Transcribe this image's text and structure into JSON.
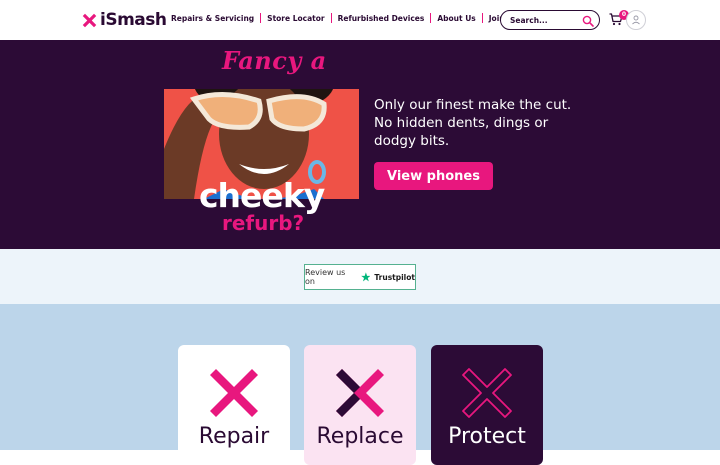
{
  "brand": {
    "name": "iSmash",
    "accent": "#e8177e",
    "dark": "#2c0b36"
  },
  "nav": {
    "items": [
      {
        "label": "Repairs & Servicing"
      },
      {
        "label": "Store Locator"
      },
      {
        "label": "Refurbished Devices"
      },
      {
        "label": "About Us"
      },
      {
        "label": "Join Our Team"
      }
    ]
  },
  "search": {
    "placeholder": "Search...",
    "icon": "search-icon"
  },
  "cart": {
    "count": "0",
    "icon": "cart-icon"
  },
  "account": {
    "icon": "user-icon"
  },
  "hero": {
    "headline_top": "Fancy a",
    "headline_big": "cheeky",
    "headline_sub": "refurb?",
    "copy": "Only our finest make the cut. No hidden dents, dings or dodgy bits.",
    "cta": "View phones"
  },
  "trustpilot": {
    "prefix": "Review us on",
    "brand": "Trustpilot"
  },
  "cards": [
    {
      "label": "Repair"
    },
    {
      "label": "Replace"
    },
    {
      "label": "Protect"
    }
  ]
}
